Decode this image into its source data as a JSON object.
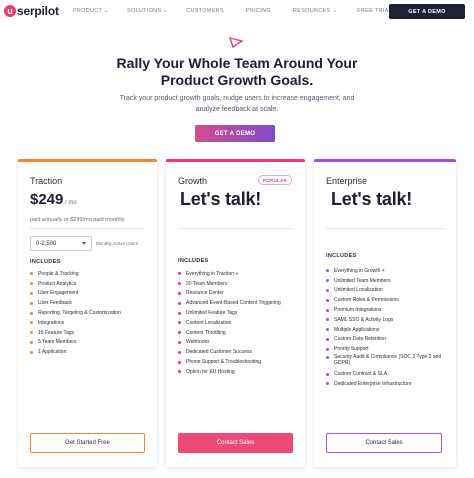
{
  "colors": {
    "accent_pink": "#e93c6a",
    "traction_orange": "#f0883a",
    "enterprise_purple": "#a24fe0",
    "nav_dark": "#1e2134"
  },
  "nav": {
    "logo_mark": "u",
    "logo_text": "serpilot",
    "links": [
      {
        "label": "PRODUCT ⌄"
      },
      {
        "label": "SOLUTIONS ⌄"
      },
      {
        "label": "CUSTOMERS"
      },
      {
        "label": "PRICING"
      },
      {
        "label": "RESOURCES ⌄"
      },
      {
        "label": "FREE TRIAL"
      }
    ],
    "cta_label": "GET A DEMO"
  },
  "hero": {
    "title_line1": "Rally Your Whole Team Around Your",
    "title_line2": "Product Growth Goals.",
    "subtitle_line1": "Track your product growth goals, nudge users to increase engagement, and",
    "subtitle_line2": "analyze feedback at scale.",
    "cta_label": "GET A DEMO"
  },
  "plans": {
    "traction": {
      "name": "Traction",
      "price": "$249",
      "price_unit": " / mo",
      "billing_note": "paid annually or $299/mo paid monthly",
      "mau_select_value": "0-2,500",
      "mau_label": "Monthly Active Users",
      "includes_label": "INCLUDES",
      "features": [
        "People & Tracking",
        "Product Analytics",
        "User Engagement",
        "User Feedback",
        "Reporting, Targeting & Customization",
        "Integrations",
        "15 Feature Tags",
        "5 Team Members",
        "1 Application"
      ],
      "button_label": "Get Started Free"
    },
    "growth": {
      "name": "Growth",
      "badge": "POPULAR",
      "headline": "Let's talk!",
      "includes_label": "INCLUDES",
      "features": [
        "Everything in Traction +",
        "20 Team Members",
        "Resource Center",
        "Advanced Event-Based Content Triggering",
        "Unlimited Feature Tags",
        "Content Localization",
        "Content Throttling",
        "Webhooks",
        "Dedicated Customer Success",
        "Phone Support & Troubleshooting",
        "Option for EU Hosting"
      ],
      "button_label": "Contact Sales"
    },
    "enterprise": {
      "name": "Enterprise",
      "headline": "Let's talk!",
      "includes_label": "INCLUDES",
      "features": [
        "Everything in Growth +",
        "Unlimited Team Members",
        "Unlimited Localization",
        "Custom Roles & Permissions",
        "Premium Integrations",
        "SAML SSO & Activity Logs",
        "Multiple Applications",
        "Custom Data Retention",
        "Priority Support",
        "Security Audit & Compliance (SOC 2 Type 2 and GDPR)",
        "Custom Contract & SLA",
        "Dedicated Enterprise Infrastructure"
      ],
      "button_label": "Contact Sales"
    }
  }
}
